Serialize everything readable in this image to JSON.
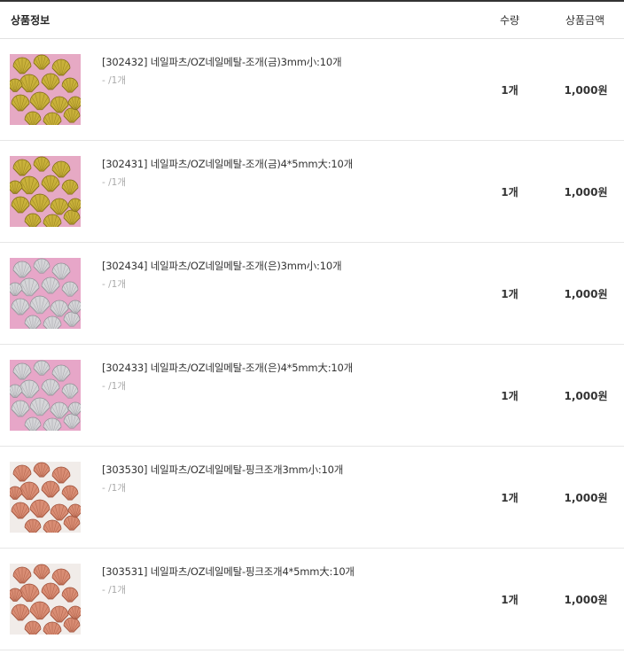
{
  "header": {
    "info_label": "상품정보",
    "qty_label": "수량",
    "amount_label": "상품금액"
  },
  "items": [
    {
      "name": "[302432] 네일파츠/OZ네일메탈-조개(금)3mm小:10개",
      "option": "- /1개",
      "qty": "1개",
      "amount": "1,000원",
      "variant": "gold"
    },
    {
      "name": "[302431] 네일파츠/OZ네일메탈-조개(금)4*5mm大:10개",
      "option": "- /1개",
      "qty": "1개",
      "amount": "1,000원",
      "variant": "gold"
    },
    {
      "name": "[302434] 네일파츠/OZ네일메탈-조개(은)3mm小:10개",
      "option": "- /1개",
      "qty": "1개",
      "amount": "1,000원",
      "variant": "silver"
    },
    {
      "name": "[302433] 네일파츠/OZ네일메탈-조개(은)4*5mm大:10개",
      "option": "- /1개",
      "qty": "1개",
      "amount": "1,000원",
      "variant": "silver"
    },
    {
      "name": "[303530] 네일파츠/OZ네일메탈-핑크조개3mm小:10개",
      "option": "- /1개",
      "qty": "1개",
      "amount": "1,000원",
      "variant": "pink"
    },
    {
      "name": "[303531] 네일파츠/OZ네일메탈-핑크조개4*5mm大:10개",
      "option": "- /1개",
      "qty": "1개",
      "amount": "1,000원",
      "variant": "pink"
    }
  ],
  "colors": {
    "header_border": "#333333",
    "row_border": "#e6e6e6",
    "option_text": "#aaaaaa",
    "gold_bg": "#e6a9c4",
    "gold_shell": "#c9b13a",
    "silver_bg": "#e7a6c8",
    "silver_shell": "#d5d5d8",
    "pink_bg": "#f1ece9",
    "pink_shell": "#d98d74"
  }
}
